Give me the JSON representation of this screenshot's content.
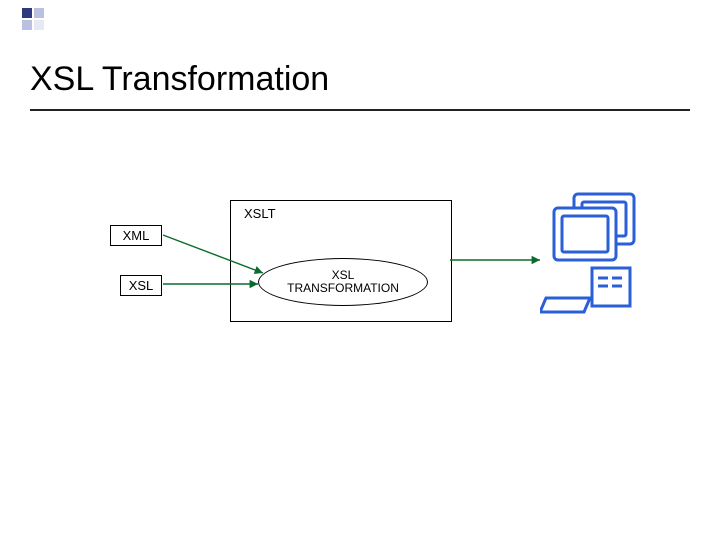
{
  "slide": {
    "title": "XSL Transformation"
  },
  "diagram": {
    "input1": "XML",
    "input2": "XSL",
    "proc_label": "XSLT",
    "transform_line1": "XSL",
    "transform_line2": "TRANSFORMATION",
    "output_icon": "computer-icon"
  },
  "colors": {
    "arrow": "#0a6b2c",
    "computer": "#2a5fd8"
  }
}
